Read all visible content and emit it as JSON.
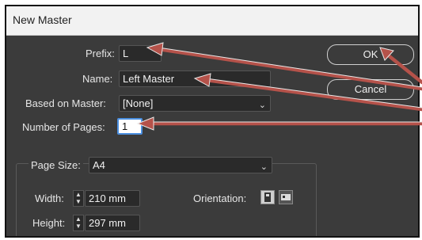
{
  "window": {
    "title": "New Master"
  },
  "form": {
    "prefix_label": "Prefix:",
    "prefix_value": "L",
    "name_label": "Name:",
    "name_value": "Left Master",
    "based_on_label": "Based on Master:",
    "based_on_value": "[None]",
    "pages_label": "Number of Pages:",
    "pages_value": "1",
    "page_size_label": "Page Size:",
    "page_size_value": "A4",
    "width_label": "Width:",
    "width_value": "210 mm",
    "height_label": "Height:",
    "height_value": "297 mm",
    "orientation_label": "Orientation:"
  },
  "buttons": {
    "ok": "OK",
    "cancel": "Cancel"
  },
  "colors": {
    "dialog_bg": "#3b3b3b",
    "arrow": "#b5524a",
    "focus": "#4b8fe0"
  },
  "icons": [
    "chevron-down-icon",
    "stepper-icon",
    "portrait-icon",
    "landscape-icon"
  ]
}
